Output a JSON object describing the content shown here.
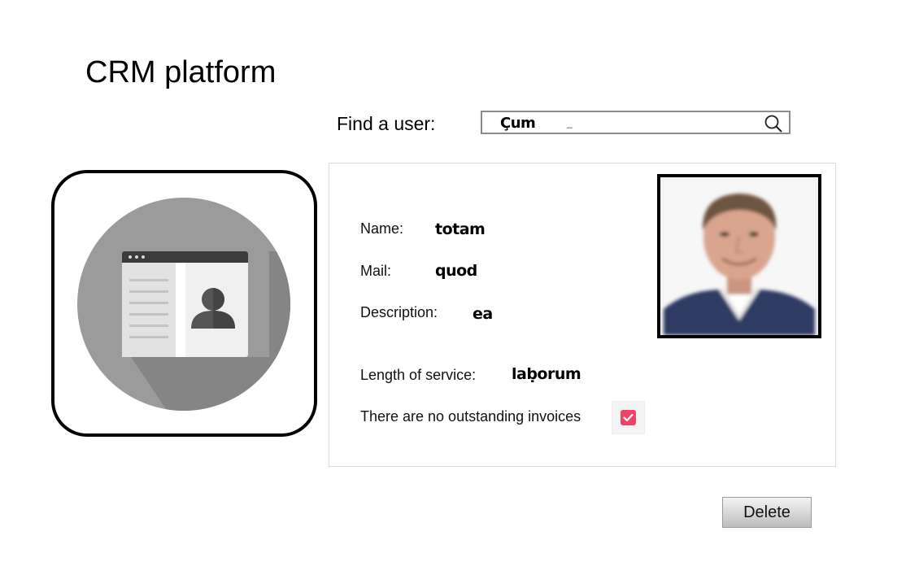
{
  "app": {
    "title": "CRM platform"
  },
  "search": {
    "label": "Find a user:",
    "value": "Çum",
    "cursor": "_",
    "icon": "search-icon"
  },
  "user": {
    "fields": [
      {
        "label": "Name:",
        "value": "totam"
      },
      {
        "label": "Mail:",
        "value": "quod"
      },
      {
        "label": "Description:",
        "value": "ea"
      },
      {
        "label": "Length of service:",
        "value": "laḅorum"
      }
    ],
    "invoices": {
      "label": "There are no outstanding invoices",
      "checked": true
    },
    "avatar_icon": "contact-card-icon",
    "photo": "user-photo"
  },
  "actions": {
    "delete_label": "Delete"
  },
  "colors": {
    "checkbox": "#f0436a",
    "avatar_circle": "#9b9b9b",
    "avatar_shadow": "#838383"
  }
}
